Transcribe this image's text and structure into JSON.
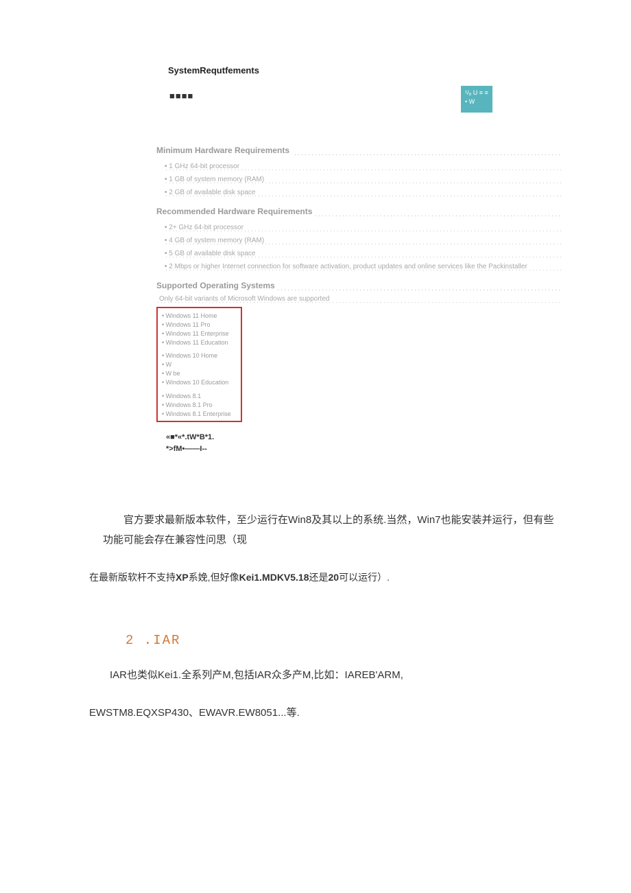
{
  "header": {
    "title": "SystemRequtfements",
    "dashes": "■■■■"
  },
  "badge": "¹/₈ U ≡ ≡ • W",
  "minimum": {
    "heading": "Minimum Hardware Requirements",
    "items": [
      "1 GHz 64-bit processor",
      "1 GB of system memory (RAM)",
      "2 GB of available disk space"
    ]
  },
  "recommended": {
    "heading": "Recommended Hardware Requirements",
    "items": [
      "2+ GHz 64-bit processor",
      "4 GB of system memory (RAM)",
      "5 GB of available disk space",
      "2 Mbps or higher Internet connection for software activation, product updates and online services like the Packinstaller"
    ]
  },
  "supported": {
    "heading": "Supported Operating Systems",
    "note": "Only 64-bit variants of Microsoft Windows are supported",
    "os": [
      "Windows 11 Home",
      "Windows 11 Pro",
      "Windows 11 Enterprise",
      "Windows 11 Education",
      "Windows 10 Home",
      "W",
      "W                    be",
      "Windows 10 Education",
      "Windows 8.1",
      "Windows 8.1 Pro",
      "Windows 8.1 Enterprise"
    ]
  },
  "garble_1": "«■*«*.tW*B*1.",
  "garble_2": "*>fM•——I--",
  "para1": "官方要求最新版本软件，至少运行在Win8及其以上的系统.当然，Win7也能安装并运行，但有些功能可能会存在兼容性问思（现",
  "para2_a": "在最新版软杆不支持",
  "para2_b": "XP",
  "para2_c": "系娩,但好像",
  "para2_d": "Kei1.MDKV5.18",
  "para2_e": "还是",
  "para2_f": "20",
  "para2_g": "可以运行）.",
  "section_label": "2 .IAR",
  "para3": "IAR也类似Kei1.全系列产M,包括IAR众多产M,比如：IAREB'ARM,",
  "para4": "EWSTM8.EQXSP430、EWAVR.EW8051...等."
}
